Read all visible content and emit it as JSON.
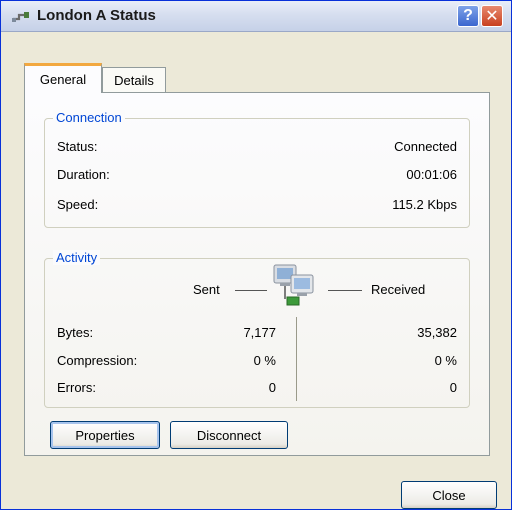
{
  "window": {
    "title": "London A Status",
    "help_label": "?",
    "close_label": "✕"
  },
  "tabs": [
    {
      "label": "General",
      "selected": true
    },
    {
      "label": "Details",
      "selected": false
    }
  ],
  "connection": {
    "legend": "Connection",
    "rows": [
      {
        "label": "Status:",
        "value": "Connected"
      },
      {
        "label": "Duration:",
        "value": "00:01:06"
      },
      {
        "label": "Speed:",
        "value": "115.2 Kbps"
      }
    ]
  },
  "activity": {
    "legend": "Activity",
    "sent_label": "Sent",
    "received_label": "Received",
    "icon": "network-computers-icon",
    "rows": [
      {
        "label": "Bytes:",
        "sent": "7,177",
        "received": "35,382"
      },
      {
        "label": "Compression:",
        "sent": "0 %",
        "received": "0 %"
      },
      {
        "label": "Errors:",
        "sent": "0",
        "received": "0"
      }
    ]
  },
  "buttons": {
    "properties": "Properties",
    "disconnect": "Disconnect",
    "close": "Close"
  },
  "colors": {
    "accent": "#0046d5",
    "tab_highlight": "#f2a840",
    "close_button": "#c8401f"
  }
}
